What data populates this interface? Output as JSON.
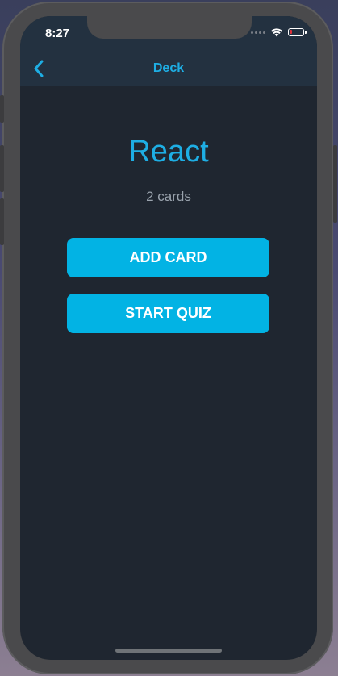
{
  "status_bar": {
    "time": "8:27"
  },
  "nav": {
    "title": "Deck",
    "back_icon": "chevron-left-icon"
  },
  "deck": {
    "title": "React",
    "card_count": "2 cards"
  },
  "actions": {
    "add_card_label": "ADD CARD",
    "start_quiz_label": "START QUIZ"
  },
  "colors": {
    "accent": "#1eaee4",
    "button": "#02b3e4",
    "background": "#1f2630",
    "nav_background": "#233140",
    "battery_low": "#e0303a"
  }
}
